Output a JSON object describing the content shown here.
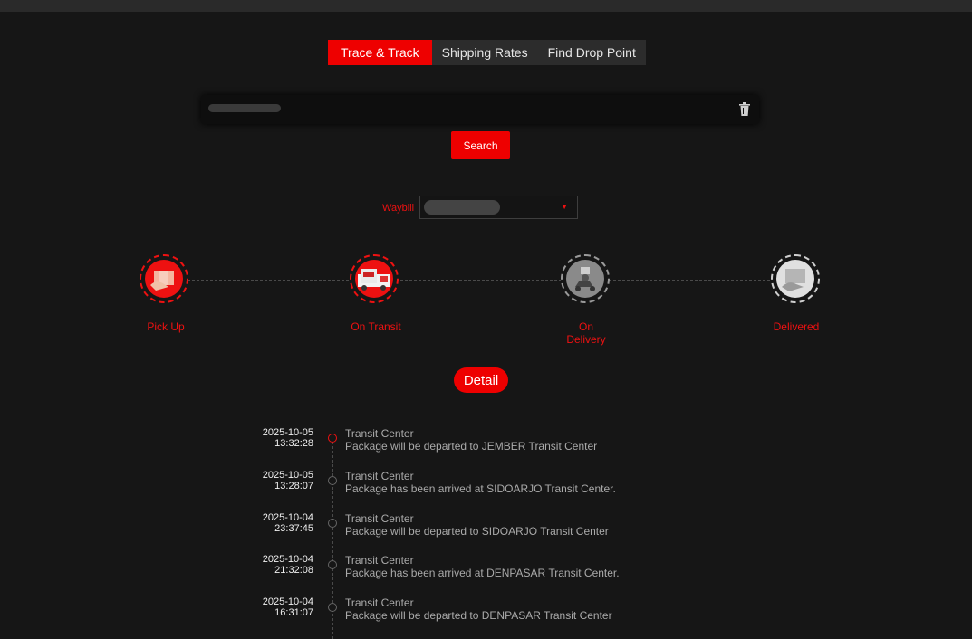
{
  "tabs": [
    {
      "label": "Trace & Track",
      "active": true
    },
    {
      "label": "Shipping Rates",
      "active": false
    },
    {
      "label": "Find Drop Point",
      "active": false
    }
  ],
  "search": {
    "value": "",
    "button_label": "Search",
    "clear_icon": "trash-icon"
  },
  "waybill": {
    "label": "Waybill",
    "selected": ""
  },
  "steps": [
    {
      "label": "Pick Up",
      "state": "active",
      "icon": "pickup-icon"
    },
    {
      "label": "On Transit",
      "state": "active",
      "icon": "truck-icon"
    },
    {
      "label": "On\nDelivery",
      "state": "inactive",
      "icon": "courier-icon"
    },
    {
      "label": "Delivered",
      "state": "inactive",
      "icon": "handover-icon"
    }
  ],
  "detail_button": "Detail",
  "history": [
    {
      "date": "2025-10-05",
      "time": "13:32:28",
      "title": "Transit Center",
      "desc": "Package will be departed to JEMBER Transit Center"
    },
    {
      "date": "2025-10-05",
      "time": "13:28:07",
      "title": "Transit Center",
      "desc": "Package has been arrived at SIDOARJO Transit Center."
    },
    {
      "date": "2025-10-04",
      "time": "23:37:45",
      "title": "Transit Center",
      "desc": "Package will be departed to SIDOARJO Transit Center"
    },
    {
      "date": "2025-10-04",
      "time": "21:32:08",
      "title": "Transit Center",
      "desc": "Package has been arrived at DENPASAR Transit Center."
    },
    {
      "date": "2025-10-04",
      "time": "16:31:07",
      "title": "Transit Center",
      "desc": "Package will be departed to DENPASAR Transit Center"
    }
  ],
  "colors": {
    "accent": "#ee0000",
    "background": "#161616",
    "text_muted": "#aaaaaa"
  }
}
